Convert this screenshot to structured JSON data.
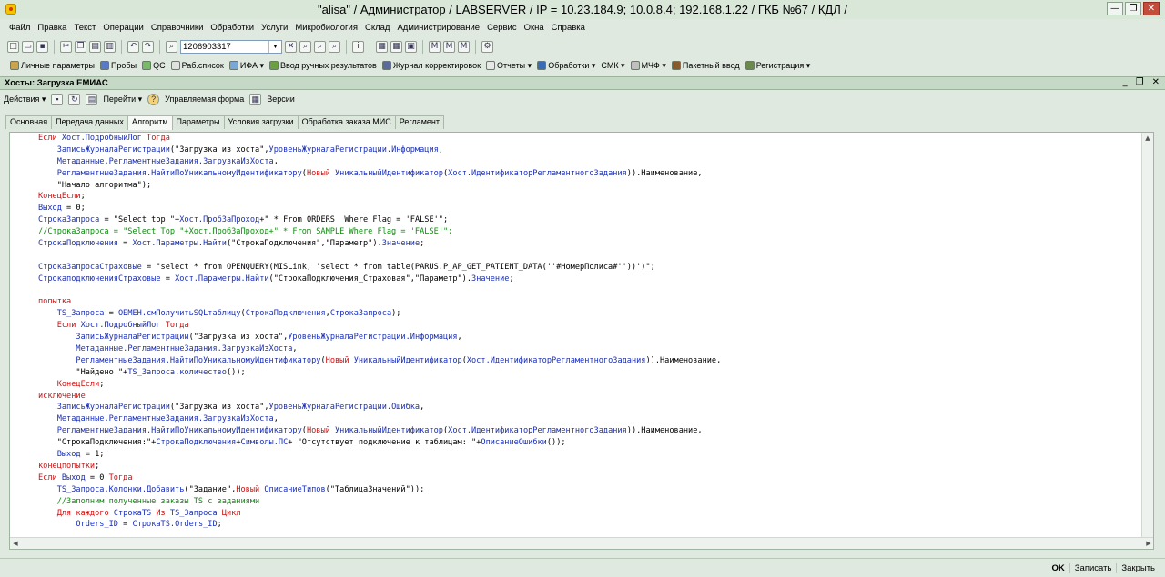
{
  "window": {
    "title": "\"alisa\" / Администратор / LABSERVER / IP = 10.23.184.9; 10.0.8.4; 192.168.1.22 / ГКБ №67 /  КДЛ /",
    "minimize": "—",
    "maximize": "❐",
    "close": "✕"
  },
  "menu": [
    "Файл",
    "Правка",
    "Текст",
    "Операции",
    "Справочники",
    "Обработки",
    "Услуги",
    "Микробиология",
    "Склад",
    "Администрирование",
    "Сервис",
    "Окна",
    "Справка"
  ],
  "toolbar1": {
    "search_value": "1206903317"
  },
  "toolbar2": {
    "items": [
      "Личные параметры",
      "Пробы",
      "QC",
      "Раб.список",
      "ИФА ▾",
      "Ввод ручных результатов",
      "Журнал корректировок",
      "Отчеты ▾",
      "Обработки ▾",
      "СМК ▾",
      "МЧФ ▾",
      "Пакетный ввод",
      "Регистрация ▾"
    ]
  },
  "subwindow": {
    "title": "Хосты: Загрузка ЕМИАС",
    "controls": [
      "_",
      "❐",
      "✕"
    ],
    "toolbar": {
      "actions": "Действия ▾",
      "goto": "Перейти ▾",
      "managed_form": "Управляемая форма",
      "versions": "Версии"
    },
    "tabs": [
      "Основная",
      "Передача данных",
      "Алгоритм",
      "Параметры",
      "Условия загрузки",
      "Обработка заказа МИС",
      "Регламент"
    ],
    "active_tab": "Алгоритм"
  },
  "code_lines": [
    [
      [
        "kw",
        "Если "
      ],
      [
        "id",
        "Хост.ПодробныйЛог "
      ],
      [
        "kw",
        "Тогда"
      ]
    ],
    [
      [
        "sp",
        "    "
      ],
      [
        "id",
        "ЗаписьЖурналаРегистрации"
      ],
      [
        "str",
        "(\"Загрузка из хоста\","
      ],
      [
        "id",
        "УровеньЖурналаРегистрации.Информация"
      ],
      [
        "str",
        ","
      ]
    ],
    [
      [
        "sp",
        "    "
      ],
      [
        "id",
        "Метаданные.РегламентныеЗадания.ЗагрузкаИзХоста"
      ],
      [
        "str",
        ","
      ]
    ],
    [
      [
        "sp",
        "    "
      ],
      [
        "id",
        "РегламентныеЗадания.НайтиПоУникальномуИдентификатору"
      ],
      [
        "str",
        "("
      ],
      [
        "kw",
        "Новый "
      ],
      [
        "id",
        "УникальныйИдентификатор"
      ],
      [
        "str",
        "("
      ],
      [
        "id",
        "Хост.ИдентификаторРегламентногоЗадания"
      ],
      [
        "str",
        ")).Наименование,"
      ]
    ],
    [
      [
        "sp",
        "    "
      ],
      [
        "str",
        "\"Начало алгоритма\");"
      ]
    ],
    [
      [
        "kw",
        "КонецЕсли"
      ],
      [
        "str",
        ";"
      ]
    ],
    [
      [
        "id",
        "Выход "
      ],
      [
        "str",
        "= 0;"
      ]
    ],
    [
      [
        "id",
        "СтрокаЗапроса "
      ],
      [
        "str",
        "= \"Select top \"+"
      ],
      [
        "id",
        "Хост.ПробЗаПроход"
      ],
      [
        "str",
        "+\" * From ORDERS  Where Flag = 'FALSE'\";"
      ]
    ],
    [
      [
        "cm",
        "//СтрокаЗапроса = \"Select Top \"+Хост.ПробЗаПроход+\" * From SAMPLE Where Flag = 'FALSE'\";"
      ]
    ],
    [
      [
        "id",
        "СтрокаПодключения "
      ],
      [
        "str",
        "= "
      ],
      [
        "id",
        "Хост.Параметры.Найти"
      ],
      [
        "str",
        "(\"СтрокаПодключения\",\"Параметр\")."
      ],
      [
        "id",
        "Значение"
      ],
      [
        "str",
        ";"
      ]
    ],
    [],
    [
      [
        "id",
        "СтрокаЗапросаСтраховые "
      ],
      [
        "str",
        "= \"select * from OPENQUERY(MISLink, 'select * from table(PARUS.P_AP_GET_PATIENT_DATA(''#НомерПолиса#''))')\";"
      ]
    ],
    [
      [
        "id",
        "СтрокаподключенияСтраховые "
      ],
      [
        "str",
        "= "
      ],
      [
        "id",
        "Хост.Параметры.Найти"
      ],
      [
        "str",
        "(\"СтрокаПодключения_Страховая\",\"Параметр\")."
      ],
      [
        "id",
        "Значение"
      ],
      [
        "str",
        ";"
      ]
    ],
    [],
    [
      [
        "kw",
        "попытка"
      ]
    ],
    [
      [
        "sp",
        "    "
      ],
      [
        "id",
        "TS_Запроса "
      ],
      [
        "str",
        "= "
      ],
      [
        "id",
        "ОБМЕН.смПолучитьSQLтаблицу"
      ],
      [
        "str",
        "("
      ],
      [
        "id",
        "СтрокаПодключения"
      ],
      [
        "str",
        ","
      ],
      [
        "id",
        "СтрокаЗапроса"
      ],
      [
        "str",
        ");"
      ]
    ],
    [
      [
        "sp",
        "    "
      ],
      [
        "kw",
        "Если "
      ],
      [
        "id",
        "Хост.ПодробныйЛог "
      ],
      [
        "kw",
        "Тогда"
      ]
    ],
    [
      [
        "sp",
        "        "
      ],
      [
        "id",
        "ЗаписьЖурналаРегистрации"
      ],
      [
        "str",
        "(\"Загрузка из хоста\","
      ],
      [
        "id",
        "УровеньЖурналаРегистрации.Информация"
      ],
      [
        "str",
        ","
      ]
    ],
    [
      [
        "sp",
        "        "
      ],
      [
        "id",
        "Метаданные.РегламентныеЗадания.ЗагрузкаИзХоста"
      ],
      [
        "str",
        ","
      ]
    ],
    [
      [
        "sp",
        "        "
      ],
      [
        "id",
        "РегламентныеЗадания.НайтиПоУникальномуИдентификатору"
      ],
      [
        "str",
        "("
      ],
      [
        "kw",
        "Новый "
      ],
      [
        "id",
        "УникальныйИдентификатор"
      ],
      [
        "str",
        "("
      ],
      [
        "id",
        "Хост.ИдентификаторРегламентногоЗадания"
      ],
      [
        "str",
        ")).Наименование,"
      ]
    ],
    [
      [
        "sp",
        "        "
      ],
      [
        "str",
        "\"Найдено \"+"
      ],
      [
        "id",
        "TS_Запроса.количество"
      ],
      [
        "str",
        "());"
      ]
    ],
    [
      [
        "sp",
        "    "
      ],
      [
        "kw",
        "КонецЕсли"
      ],
      [
        "str",
        ";"
      ]
    ],
    [
      [
        "kw",
        "исключение"
      ]
    ],
    [
      [
        "sp",
        "    "
      ],
      [
        "id",
        "ЗаписьЖурналаРегистрации"
      ],
      [
        "str",
        "(\"Загрузка из хоста\","
      ],
      [
        "id",
        "УровеньЖурналаРегистрации.Ошибка"
      ],
      [
        "str",
        ","
      ]
    ],
    [
      [
        "sp",
        "    "
      ],
      [
        "id",
        "Метаданные.РегламентныеЗадания.ЗагрузкаИзХоста"
      ],
      [
        "str",
        ","
      ]
    ],
    [
      [
        "sp",
        "    "
      ],
      [
        "id",
        "РегламентныеЗадания.НайтиПоУникальномуИдентификатору"
      ],
      [
        "str",
        "("
      ],
      [
        "kw",
        "Новый "
      ],
      [
        "id",
        "УникальныйИдентификатор"
      ],
      [
        "str",
        "("
      ],
      [
        "id",
        "Хост.ИдентификаторРегламентногоЗадания"
      ],
      [
        "str",
        ")).Наименование,"
      ]
    ],
    [
      [
        "sp",
        "    "
      ],
      [
        "str",
        "\"СтрокаПодключения:\"+"
      ],
      [
        "id",
        "СтрокаПодключения"
      ],
      [
        "str",
        "+"
      ],
      [
        "id",
        "Символы.ПС"
      ],
      [
        "str",
        "+ \"Отсутствует подключение к таблицам: \"+"
      ],
      [
        "id",
        "ОписаниеОшибки"
      ],
      [
        "str",
        "());"
      ]
    ],
    [
      [
        "sp",
        "    "
      ],
      [
        "id",
        "Выход "
      ],
      [
        "str",
        "= 1;"
      ]
    ],
    [
      [
        "kw",
        "конецпопытки"
      ],
      [
        "str",
        ";"
      ]
    ],
    [
      [
        "kw",
        "Если "
      ],
      [
        "id",
        "Выход "
      ],
      [
        "str",
        "= 0 "
      ],
      [
        "kw",
        "Тогда"
      ]
    ],
    [
      [
        "sp",
        "    "
      ],
      [
        "id",
        "TS_Запроса.Колонки.Добавить"
      ],
      [
        "str",
        "(\"Задание\","
      ],
      [
        "kw",
        "Новый "
      ],
      [
        "id",
        "ОписаниеТипов"
      ],
      [
        "str",
        "(\"ТаблицаЗначений\"));"
      ]
    ],
    [
      [
        "sp",
        "    "
      ],
      [
        "cm",
        "//Заполним полученные заказы TS с заданиями"
      ]
    ],
    [
      [
        "sp",
        "    "
      ],
      [
        "kw",
        "Для каждого "
      ],
      [
        "id",
        "СтрокаTS "
      ],
      [
        "kw",
        "Из "
      ],
      [
        "id",
        "TS_Запроса "
      ],
      [
        "kw",
        "Цикл"
      ]
    ],
    [
      [
        "sp",
        "        "
      ],
      [
        "id",
        "Orders_ID "
      ],
      [
        "str",
        "= "
      ],
      [
        "id",
        "СтрокаTS.Orders_ID"
      ],
      [
        "str",
        ";"
      ]
    ]
  ],
  "bottom_bar": {
    "ok": "OK",
    "save": "Записать",
    "close": "Закрыть"
  }
}
